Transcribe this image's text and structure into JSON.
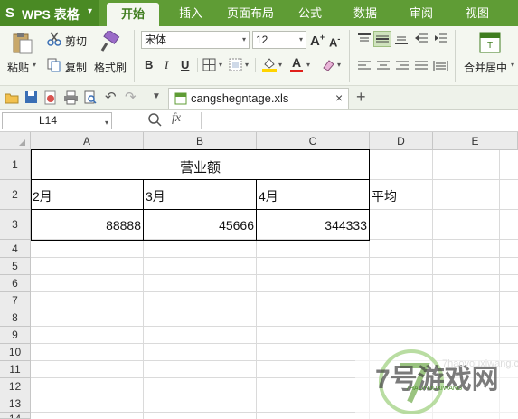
{
  "app": {
    "logo": "S",
    "title": "WPS 表格",
    "dropdown": "▾"
  },
  "tabs": [
    {
      "label": "开始",
      "active": true
    },
    {
      "label": "插入"
    },
    {
      "label": "页面布局"
    },
    {
      "label": "公式"
    },
    {
      "label": "数据"
    },
    {
      "label": "审阅"
    },
    {
      "label": "视图"
    }
  ],
  "ribbon": {
    "paste": "粘贴",
    "cut": "剪切",
    "copy": "复制",
    "format_painter": "格式刷",
    "font_name": "宋体",
    "font_size": "12",
    "bold": "B",
    "italic": "I",
    "underline": "U",
    "font_color_letter": "A",
    "merge_center": "合并居中"
  },
  "quickbar": {
    "file_name": "cangshegntage.xls",
    "close": "×",
    "new_tab": "+"
  },
  "formula_bar": {
    "cell_ref": "L14",
    "fx": "fx"
  },
  "columns": [
    "A",
    "B",
    "C",
    "D",
    "E"
  ],
  "rows": [
    "1",
    "2",
    "3",
    "4",
    "5",
    "6",
    "7",
    "8",
    "9",
    "10",
    "11",
    "12",
    "13",
    "14"
  ],
  "cells": {
    "title": "营业额",
    "a2": "2月",
    "b2": "3月",
    "c2": "4月",
    "d2": "平均",
    "a3": "88888",
    "b3": "45666",
    "c3": "344333"
  },
  "watermark": {
    "big": "7号游戏网",
    "small": "7HAOYOUXIWANG",
    "url": "7haoyouxiwang.com"
  },
  "colors": {
    "brand_green": "#5f9c35",
    "tab_active_text": "#3f7d1f"
  }
}
